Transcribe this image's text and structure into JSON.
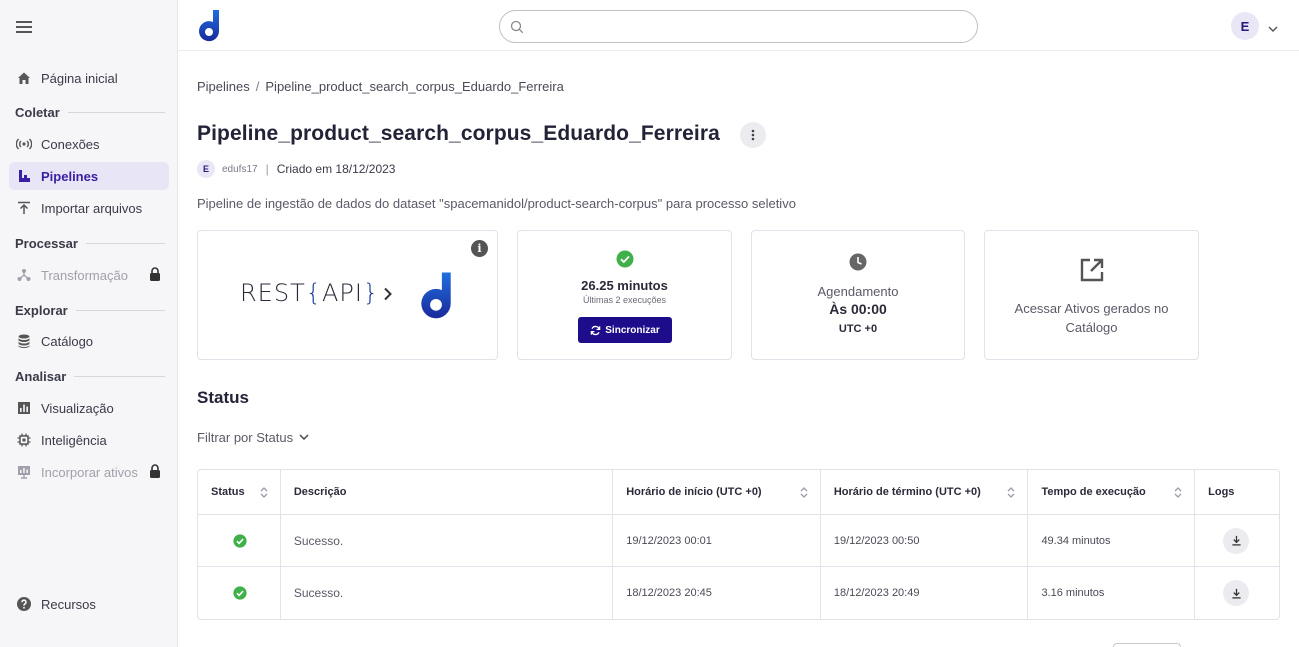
{
  "sidebar": {
    "items": {
      "home": "Página inicial",
      "connections": "Conexões",
      "pipelines": "Pipelines",
      "import": "Importar arquivos",
      "transform": "Transformação",
      "catalog": "Catálogo",
      "visualization": "Visualização",
      "intelligence": "Inteligência",
      "embed": "Incorporar ativos",
      "resources": "Recursos"
    },
    "sections": {
      "collect": "Coletar",
      "process": "Processar",
      "explore": "Explorar",
      "analyze": "Analisar"
    }
  },
  "topbar": {
    "search_placeholder": "",
    "avatar_letter": "E"
  },
  "breadcrumb": {
    "root": "Pipelines",
    "separator": "/",
    "current": "Pipeline_product_search_corpus_Eduardo_Ferreira"
  },
  "pipeline": {
    "title": "Pipeline_product_search_corpus_Eduardo_Ferreira",
    "owner_initial": "E",
    "owner": "edufs17",
    "separator": "|",
    "created": "Criado em 18/12/2023",
    "description": "Pipeline de ingestão de dados do dataset \"spacemanidol/product-search-corpus\" para processo seletivo"
  },
  "cards": {
    "source": {
      "rest": "REST",
      "api": "API",
      "info": "i"
    },
    "run": {
      "duration": "26.25 minutos",
      "subtitle": "Últimas 2 execuções",
      "sync_label": "Sincronizar"
    },
    "schedule": {
      "label": "Agendamento",
      "time": "Às 00:00",
      "timezone": "UTC +0"
    },
    "catalog": {
      "text": "Acessar Ativos gerados no Catálogo"
    }
  },
  "status": {
    "title": "Status",
    "filter_label": "Filtrar por Status",
    "columns": [
      "Status",
      "Descrição",
      "Horário de início (UTC +0)",
      "Horário de término (UTC +0)",
      "Tempo de execução",
      "Logs"
    ],
    "rows": [
      {
        "description": "Sucesso.",
        "start": "19/12/2023 00:01",
        "end": "19/12/2023 00:50",
        "duration": "49.34 minutos"
      },
      {
        "description": "Sucesso.",
        "start": "18/12/2023 20:45",
        "end": "18/12/2023 20:49",
        "duration": "3.16 minutos"
      }
    ]
  },
  "colors": {
    "accent": "#1e0d8a",
    "active_nav_bg": "#e8e5f6",
    "success": "#3fb04a"
  }
}
